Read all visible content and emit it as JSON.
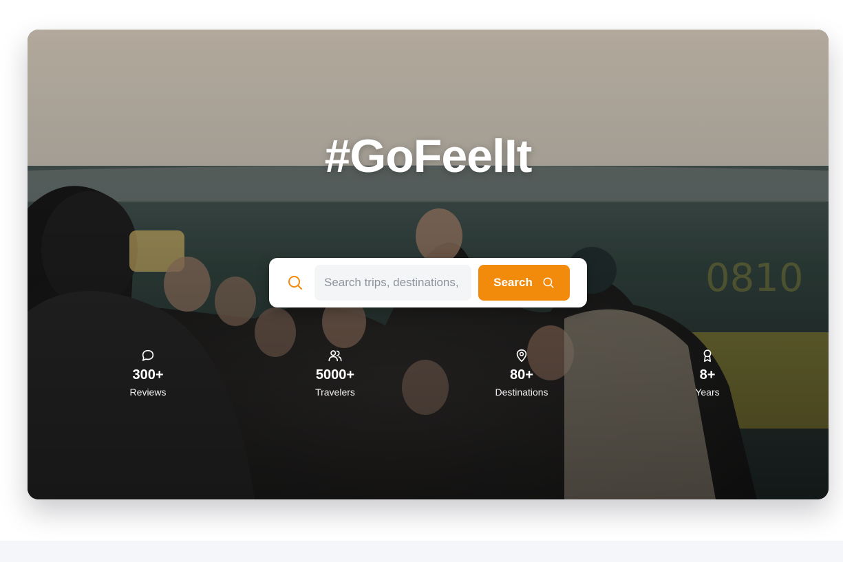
{
  "hero": {
    "headline": "#GoFeelIt"
  },
  "search": {
    "placeholder": "Search trips, destinations,",
    "button_label": "Search",
    "leading_icon": "search-icon",
    "button_icon": "search-icon",
    "accent_color": "#f28a0c"
  },
  "stats": [
    {
      "icon": "chat-bubble-icon",
      "value": "300+",
      "label": "Reviews"
    },
    {
      "icon": "users-icon",
      "value": "5000+",
      "label": "Travelers"
    },
    {
      "icon": "map-pin-icon",
      "value": "80+",
      "label": "Destinations"
    },
    {
      "icon": "award-icon",
      "value": "8+",
      "label": "Years"
    }
  ]
}
